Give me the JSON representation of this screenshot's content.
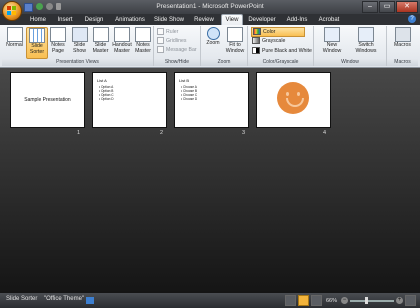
{
  "window": {
    "title": "Presentation1 - Microsoft PowerPoint"
  },
  "window_controls": {
    "minimize": "–",
    "maximize": "▭",
    "close": "✕"
  },
  "tabs": [
    "Home",
    "Insert",
    "Design",
    "Animations",
    "Slide Show",
    "Review",
    "View",
    "Developer",
    "Add-Ins",
    "Acrobat"
  ],
  "active_tab": "View",
  "help_label": "?",
  "ribbon": {
    "presentation_views": {
      "label": "Presentation Views",
      "buttons": [
        {
          "label": "Normal",
          "icon": "normal-view-icon"
        },
        {
          "label": "Slide Sorter",
          "icon": "slide-sorter-icon",
          "selected": true
        },
        {
          "label": "Notes Page",
          "icon": "notes-page-icon"
        },
        {
          "label": "Slide Show",
          "icon": "slide-show-icon"
        },
        {
          "label": "Slide Master",
          "icon": "slide-master-icon"
        },
        {
          "label": "Handout Master",
          "icon": "handout-master-icon"
        },
        {
          "label": "Notes Master",
          "icon": "notes-master-icon"
        }
      ]
    },
    "show_hide": {
      "label": "Show/Hide",
      "items": [
        "Ruler",
        "Gridlines",
        "Message Bar"
      ]
    },
    "zoom": {
      "label": "Zoom",
      "buttons": [
        "Zoom",
        "Fit to Window"
      ]
    },
    "color_grayscale": {
      "label": "Color/Grayscale",
      "items": [
        "Color",
        "Grayscale",
        "Pure Black and White"
      ],
      "selected": "Color"
    },
    "window_group": {
      "label": "Window",
      "buttons": [
        "New Window",
        "Switch Windows"
      ]
    },
    "macros": {
      "label": "Macros",
      "button": "Macros"
    }
  },
  "slides": [
    {
      "number": "1",
      "type": "title",
      "title": "Sample Presentation"
    },
    {
      "number": "2",
      "type": "list",
      "title": "List A",
      "bullets": [
        "• Option A",
        "• Option B",
        "• Option C",
        "• Option D"
      ]
    },
    {
      "number": "3",
      "type": "list",
      "title": "List B",
      "bullets": [
        "• Choose A",
        "• Choose B",
        "• Choose C",
        "• Choose D"
      ]
    },
    {
      "number": "4",
      "type": "image",
      "image": "smiley-face"
    }
  ],
  "status_bar": {
    "view": "Slide Sorter",
    "theme": "\"Office Theme\"",
    "zoom": "66%"
  },
  "colors": {
    "accent_orange": "#e6893c",
    "selected_btn": "#f9bf52"
  }
}
